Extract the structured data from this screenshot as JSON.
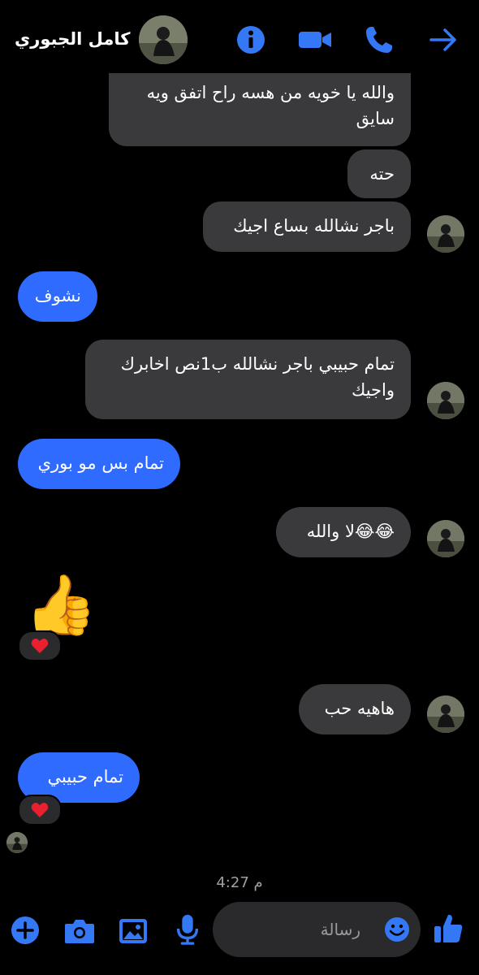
{
  "header": {
    "contact_name": "كامل الجبوري",
    "icons": [
      "info-icon",
      "video-call-icon",
      "phone-icon",
      "back-arrow-icon"
    ],
    "accent_color": "#3478f6"
  },
  "messages": [
    {
      "dir": "in",
      "text": "والله يا خويه من هسه راح اتفق ويه سايق"
    },
    {
      "dir": "in",
      "text": "حته"
    },
    {
      "dir": "in",
      "text": "باجر نشالله بساع اجيك"
    },
    {
      "dir": "out",
      "text": "نشوف"
    },
    {
      "dir": "in",
      "text": "تمام حبيبي باجر نشالله ب1نص اخابرك واجيك"
    },
    {
      "dir": "out",
      "text": "تمام بس مو بوري"
    },
    {
      "dir": "in",
      "text": "😂😂لا والله"
    },
    {
      "dir": "out",
      "text": "👍",
      "reaction": "heart"
    },
    {
      "dir": "in",
      "text": "هاهيه حب"
    },
    {
      "dir": "out",
      "text": "تمام حبيبي",
      "reaction": "heart"
    }
  ],
  "timestamp": "4:27 م",
  "composer": {
    "placeholder": "رسالة",
    "icons": [
      "plus-icon",
      "camera-icon",
      "gallery-icon",
      "microphone-icon",
      "emoji-icon",
      "like-icon"
    ]
  },
  "colors": {
    "outgoing_bubble": "#2f6bff",
    "incoming_bubble": "#3a3a3c",
    "background": "#000000"
  }
}
